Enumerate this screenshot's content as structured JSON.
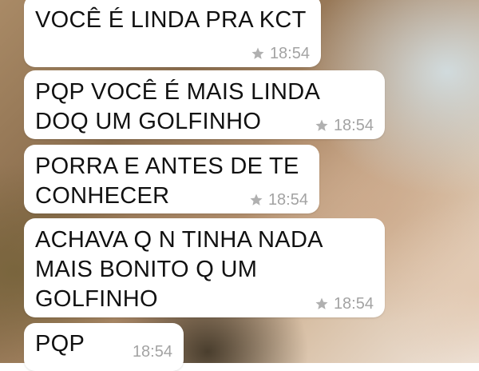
{
  "messages": [
    {
      "text": "VOCÊ É LINDA PRA KCT",
      "time": "18:54",
      "starred": true
    },
    {
      "text": "PQP VOCÊ É MAIS LINDA\nDOQ UM GOLFINHO",
      "time": "18:54",
      "starred": true
    },
    {
      "text": "PORRA E ANTES DE TE\nCONHECER",
      "time": "18:54",
      "starred": true
    },
    {
      "text": "ACHAVA Q N TINHA NADA\nMAIS BONITO Q UM\nGOLFINHO",
      "time": "18:54",
      "starred": true
    },
    {
      "text": "PQP",
      "time": "18:54",
      "starred": false
    }
  ],
  "icons": {
    "star": "star-icon"
  }
}
